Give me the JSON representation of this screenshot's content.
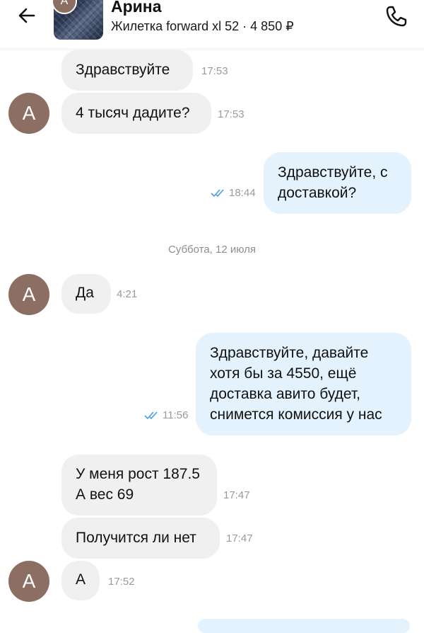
{
  "header": {
    "contact_name": "Арина",
    "item_info": "Жилетка forward xl 52 · 4 850 ₽",
    "thumb_avatar_letter": "А"
  },
  "day_separator": "Суббота, 12 июля",
  "messages": [
    {
      "dir": "in",
      "text": "Здравствуйте",
      "time": "17:53"
    },
    {
      "dir": "in",
      "text": "4 тысяч дадите?",
      "time": "17:53",
      "avatar": "А"
    },
    {
      "dir": "out",
      "lines": [
        "Здравствуйте, с",
        "доставкой?"
      ],
      "time": "18:44",
      "read": true
    },
    {
      "dir": "in",
      "text": "Да",
      "time": "4:21",
      "avatar": "А"
    },
    {
      "dir": "out",
      "lines": [
        "Здравствуйте, давайте",
        "хотя бы за 4550, ещё",
        "доставка авито будет,",
        "снимется комиссия у нас"
      ],
      "time": "11:56",
      "read": true
    },
    {
      "dir": "in",
      "lines": [
        "У меня рост 187.5",
        "А вес 69"
      ],
      "time": "17:47"
    },
    {
      "dir": "in",
      "text": "Получится ли нет",
      "time": "17:47"
    },
    {
      "dir": "in",
      "text": "А",
      "time": "17:52",
      "avatar": "А"
    }
  ],
  "colors": {
    "incoming_bubble": "#f0f0f0",
    "outgoing_bubble": "#e3f2fd",
    "avatar": "#8d6e63",
    "read_ticks": "#4a9ee8"
  },
  "icons": {
    "back": "arrow-left-icon",
    "call": "phone-icon",
    "read": "double-check-icon"
  }
}
